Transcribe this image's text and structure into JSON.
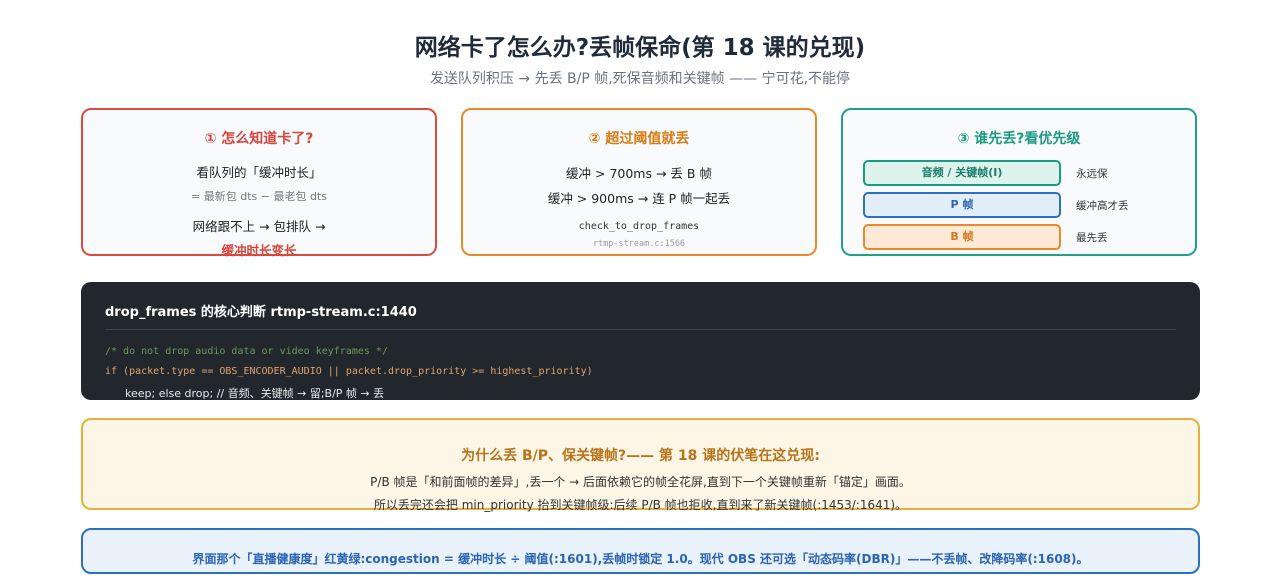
{
  "header": {
    "title": "网络卡了怎么办?丢帧保命(第 18 课的兑现)",
    "subtitle": "发送队列积压 → 先丢 B/P 帧,死保音频和关键帧 —— 宁可花,不能停"
  },
  "cards": {
    "detect": {
      "title": "① 怎么知道卡了?",
      "line1": "看队列的「缓冲时长」",
      "line2": "= 最新包 dts − 最老包 dts",
      "line3": "网络跟不上 → 包排队 →",
      "line4": "缓冲时长变长"
    },
    "threshold": {
      "title": "② 超过阈值就丢",
      "line1": "缓冲 > 700ms → 丢 B 帧",
      "line2": "缓冲 > 900ms → 连 P 帧一起丢",
      "func": "check_to_drop_frames",
      "ref": "rtmp-stream.c:1566"
    },
    "priority": {
      "title": "③ 谁先丢?看优先级",
      "items": [
        {
          "label": "音频 / 关键帧(I)",
          "desc": "永远保"
        },
        {
          "label": "P 帧",
          "desc": "缓冲高才丢"
        },
        {
          "label": "B 帧",
          "desc": "最先丢"
        }
      ]
    }
  },
  "code": {
    "heading": "drop_frames 的核心判断  rtmp-stream.c:1440",
    "comment": "/* do not drop audio data or video keyframes */",
    "if_line": "if (packet.type == OBS_ENCODER_AUDIO || packet.drop_priority >= highest_priority)",
    "keep_line": "keep;   else   drop;   // 音频、关键帧 → 留;B/P 帧 → 丢"
  },
  "why": {
    "title": "为什么丢 B/P、保关键帧?—— 第 18 课的伏笔在这兑现:",
    "line1": "P/B 帧是「和前面帧的差异」,丢一个 → 后面依赖它的帧全花屏,直到下一个关键帧重新「锚定」画面。",
    "line2": "所以丢完还会把 min_priority 抬到关键帧级:后续 P/B 帧也拒收,直到来了新关键帧(:1453/:1641)。"
  },
  "health": {
    "text": "界面那个「直播健康度」红黄绿:congestion = 缓冲时长 ÷ 阈值(:1601),丢帧时锁定 1.0。现代 OBS 还可选「动态码率(DBR)」——不丢帧、改降码率(:1608)。"
  }
}
